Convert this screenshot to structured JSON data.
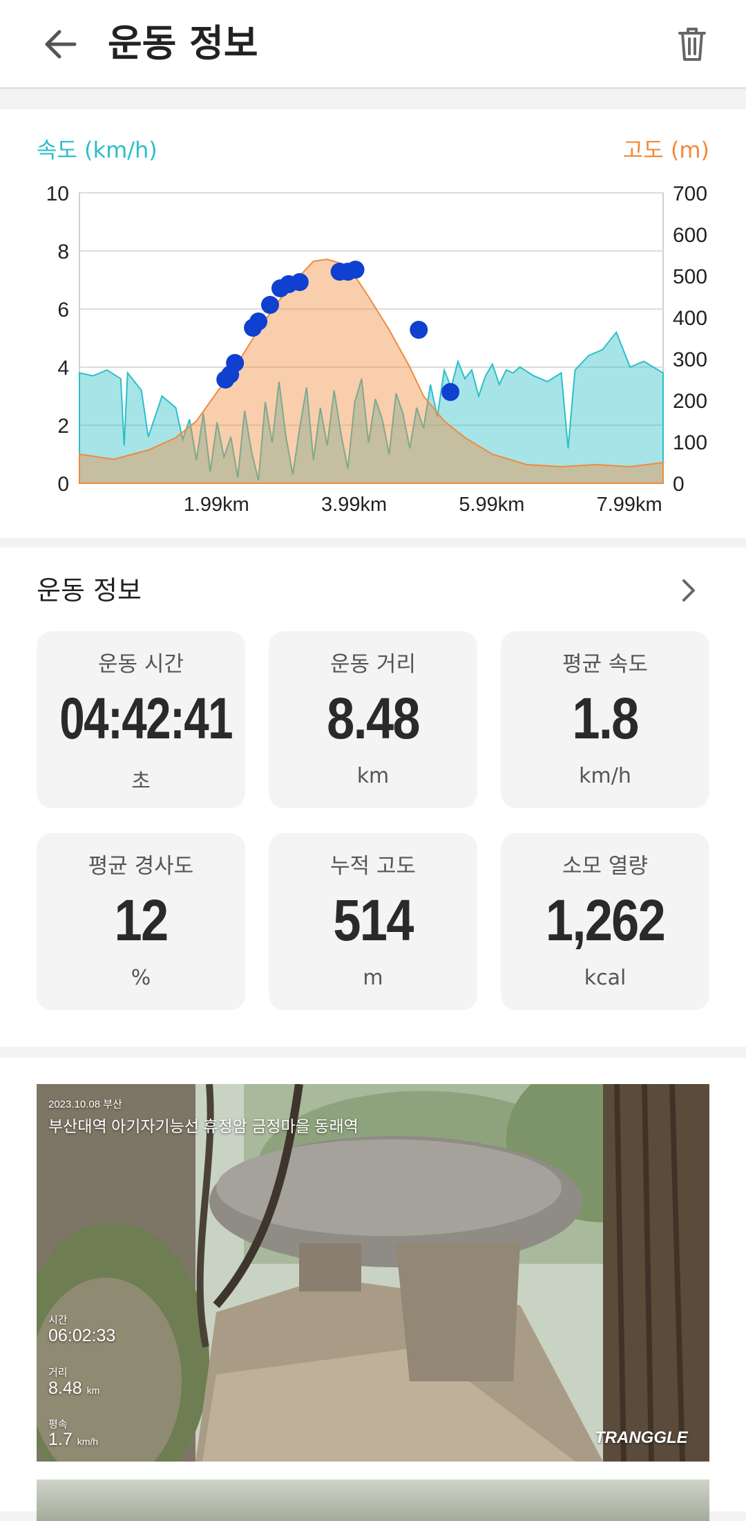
{
  "header": {
    "title": "운동 정보",
    "back_icon": "arrow-left-icon",
    "trash_icon": "trash-icon"
  },
  "chart": {
    "left_axis_label": "속도 (km/h)",
    "right_axis_label": "고도 (m)",
    "speed_color": "#2bbfc9",
    "altitude_color": "#f08a3c",
    "left_ticks": [
      "10",
      "8",
      "6",
      "4",
      "2",
      "0"
    ],
    "right_ticks": [
      "700",
      "600",
      "500",
      "400",
      "300",
      "200",
      "100",
      "0"
    ],
    "x_ticks": [
      "1.99km",
      "3.99km",
      "5.99km",
      "7.99km"
    ]
  },
  "chart_data": {
    "type": "line",
    "xlabel": "",
    "x_tick_labels": [
      "1.99km",
      "3.99km",
      "5.99km",
      "7.99km"
    ],
    "xlim_km": [
      0,
      8.48
    ],
    "ylim_left": [
      0,
      10
    ],
    "ylim_right": [
      0,
      700
    ],
    "left_axis": "속도 (km/h)",
    "right_axis": "고도 (m)",
    "grid": true,
    "series": [
      {
        "name": "속도 (km/h)",
        "type": "area",
        "color": "#2bbfc9",
        "x_km": [
          0,
          0.2,
          0.4,
          0.6,
          0.65,
          0.7,
          0.9,
          1.0,
          1.2,
          1.4,
          1.5,
          1.6,
          1.7,
          1.8,
          1.9,
          2.0,
          2.1,
          2.2,
          2.3,
          2.4,
          2.5,
          2.6,
          2.7,
          2.8,
          2.9,
          3.0,
          3.1,
          3.2,
          3.3,
          3.4,
          3.5,
          3.6,
          3.7,
          3.8,
          3.9,
          4.0,
          4.1,
          4.2,
          4.3,
          4.4,
          4.5,
          4.6,
          4.7,
          4.8,
          4.9,
          5.0,
          5.1,
          5.2,
          5.3,
          5.4,
          5.5,
          5.6,
          5.7,
          5.8,
          5.9,
          6.0,
          6.1,
          6.2,
          6.3,
          6.4,
          6.6,
          6.8,
          7.0,
          7.1,
          7.2,
          7.4,
          7.6,
          7.8,
          8.0,
          8.2,
          8.48
        ],
        "y": [
          3.8,
          3.7,
          3.9,
          3.6,
          1.3,
          3.8,
          3.2,
          1.6,
          3.0,
          2.6,
          1.5,
          2.2,
          0.8,
          2.4,
          0.4,
          2.1,
          0.9,
          1.6,
          0.2,
          2.5,
          1.1,
          0.1,
          2.8,
          1.4,
          3.5,
          1.6,
          0.3,
          1.9,
          3.3,
          0.8,
          2.6,
          1.3,
          3.2,
          1.7,
          0.5,
          2.8,
          3.6,
          1.4,
          2.9,
          2.2,
          1.0,
          3.1,
          2.4,
          1.2,
          2.6,
          1.9,
          3.4,
          2.3,
          3.9,
          3.3,
          4.2,
          3.6,
          3.9,
          3.0,
          3.7,
          4.1,
          3.4,
          3.9,
          3.8,
          4.0,
          3.7,
          3.5,
          3.8,
          1.2,
          3.9,
          4.4,
          4.6,
          5.2,
          4.0,
          4.2,
          3.8
        ]
      },
      {
        "name": "고도 (m)",
        "type": "area",
        "color": "#f08a3c",
        "x_km": [
          0,
          0.5,
          1.0,
          1.4,
          1.7,
          2.0,
          2.3,
          2.6,
          2.9,
          3.2,
          3.4,
          3.6,
          3.8,
          4.0,
          4.2,
          4.5,
          4.8,
          5.0,
          5.3,
          5.6,
          6.0,
          6.5,
          7.0,
          7.5,
          8.0,
          8.48
        ],
        "y": [
          70,
          58,
          80,
          110,
          150,
          220,
          290,
          370,
          440,
          500,
          535,
          540,
          530,
          500,
          450,
          370,
          280,
          210,
          150,
          110,
          70,
          45,
          40,
          45,
          40,
          50
        ]
      },
      {
        "name": "photo_markers",
        "type": "scatter",
        "color": "#1040d0",
        "x_km": [
          2.12,
          2.19,
          2.26,
          2.52,
          2.6,
          2.77,
          2.92,
          3.04,
          3.2,
          3.78,
          3.9,
          4.01,
          4.93,
          5.39
        ],
        "y": [
          250,
          262,
          290,
          375,
          390,
          430,
          470,
          480,
          485,
          510,
          510,
          515,
          370,
          220
        ]
      }
    ]
  },
  "section": {
    "title": "운동 정보",
    "chevron_icon": "chevron-right-icon"
  },
  "stats": [
    {
      "label": "운동 시간",
      "value": "04:42:41",
      "unit": "초"
    },
    {
      "label": "운동 거리",
      "value": "8.48",
      "unit": "km"
    },
    {
      "label": "평균 속도",
      "value": "1.8",
      "unit": "km/h"
    },
    {
      "label": "평균 경사도",
      "value": "12",
      "unit": "%"
    },
    {
      "label": "누적 고도",
      "value": "514",
      "unit": "m"
    },
    {
      "label": "소모 열량",
      "value": "1,262",
      "unit": "kcal"
    }
  ],
  "photo": {
    "date_location": "2023.10.08 부산",
    "route": "부산대역 아기자기능선 휴정암 금정마을 동래역",
    "time_label": "시간",
    "time_value": "06:02:33",
    "distance_label": "거리",
    "distance_value": "8.48",
    "distance_unit": "km",
    "speed_label": "평속",
    "speed_value": "1.7",
    "speed_unit": "km/h",
    "brand": "TRANGGLE"
  }
}
